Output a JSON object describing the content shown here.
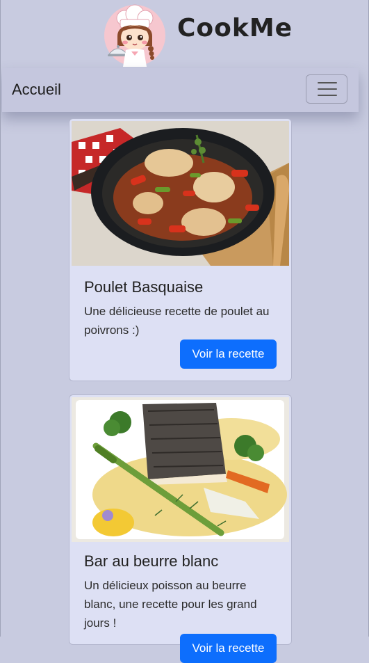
{
  "brand": {
    "name": "CookMe",
    "logo_icon": "chef-girl-mascot-icon"
  },
  "navbar": {
    "home_label": "Accueil",
    "toggler_icon": "hamburger-menu-icon"
  },
  "colors": {
    "page_background": "#c8cbe0",
    "navbar_background": "#c5c7de",
    "card_background": "#dde0f4",
    "button_primary": "#0d6efd"
  },
  "recipes": [
    {
      "title": "Poulet Basquaise",
      "description": "Une délicieuse recette de poulet au poivrons :)",
      "button_label": "Voir la recette"
    },
    {
      "title": "Bar au beurre blanc",
      "description": "Un délicieux poisson au beurre blanc, une recette pour les grand jours !",
      "button_label": "Voir la recette"
    }
  ]
}
